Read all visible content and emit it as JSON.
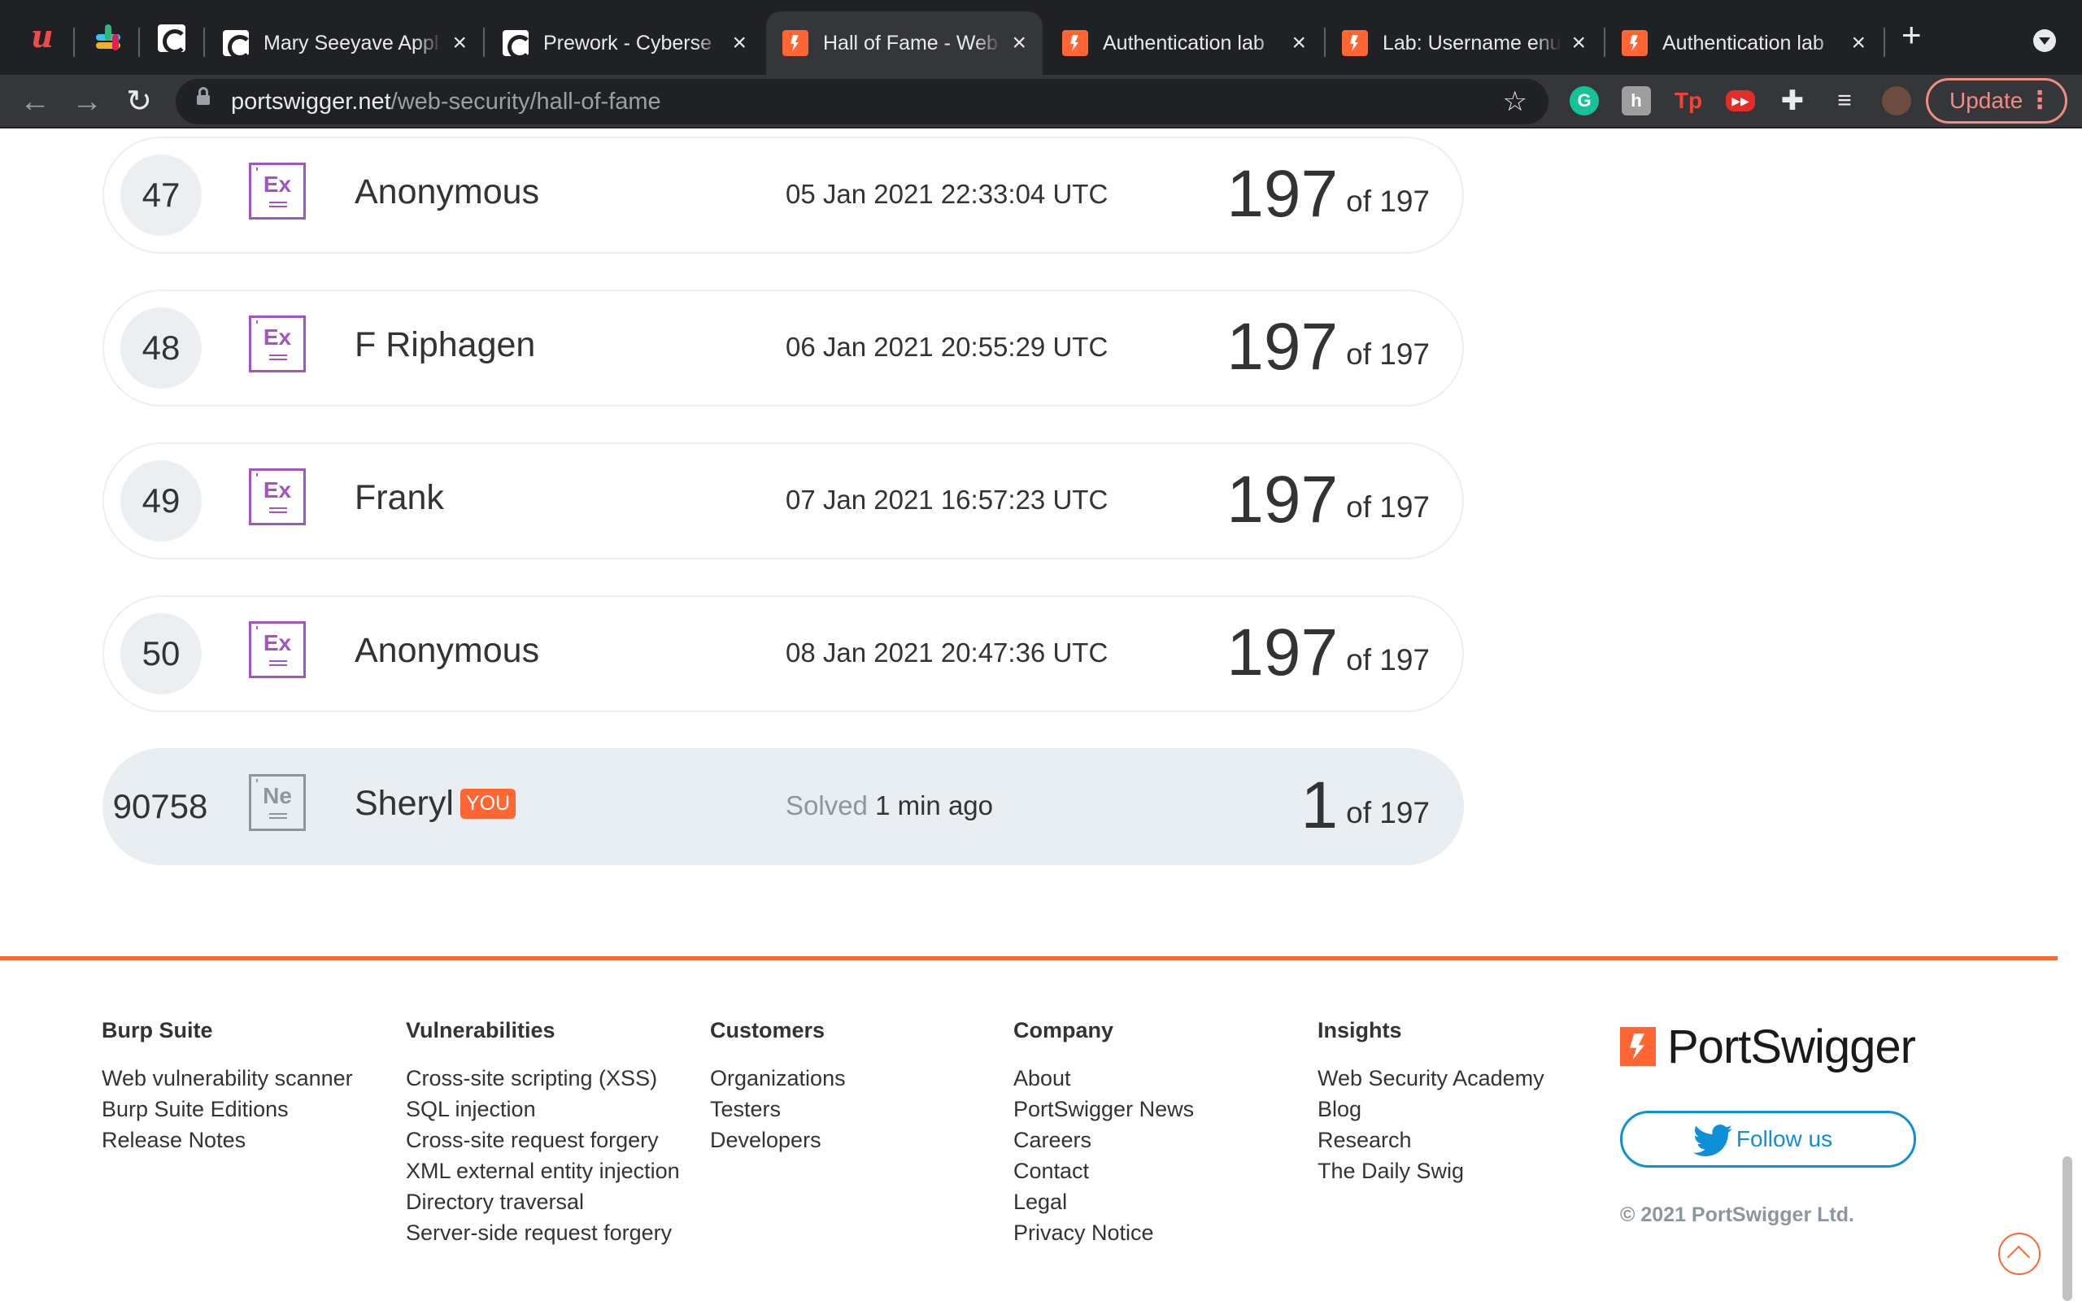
{
  "browser": {
    "tabs": [
      {
        "title": "Mary Seeyave Appl",
        "favicon": "codepath-icon"
      },
      {
        "title": "Prework - Cyberse",
        "favicon": "codepath-icon"
      },
      {
        "title": "Hall of Fame - Web",
        "favicon": "portswigger-icon",
        "active": true
      },
      {
        "title": "Authentication lab",
        "favicon": "portswigger-icon"
      },
      {
        "title": "Lab: Username enu",
        "favicon": "portswigger-icon"
      },
      {
        "title": "Authentication lab",
        "favicon": "portswigger-icon"
      }
    ],
    "close_glyph": "×",
    "new_tab_glyph": "+",
    "url_host": "portswigger.net",
    "url_path": "/web-security/hall-of-fame",
    "update_label": "Update",
    "extensions": [
      "grammarly-icon",
      "notion-icon",
      "tp-icon",
      "youtube-icon",
      "puzzle-icon",
      "playlist-icon"
    ]
  },
  "hall_of_fame": {
    "rows": [
      {
        "rank": "47",
        "badge": "Ex",
        "name": "Anonymous",
        "date": "05 Jan 2021 22:33:04 UTC",
        "score": "197",
        "of": "of 197"
      },
      {
        "rank": "48",
        "badge": "Ex",
        "name": "F Riphagen",
        "date": "06 Jan 2021 20:55:29 UTC",
        "score": "197",
        "of": "of 197"
      },
      {
        "rank": "49",
        "badge": "Ex",
        "name": "Frank",
        "date": "07 Jan 2021 16:57:23 UTC",
        "score": "197",
        "of": "of 197"
      },
      {
        "rank": "50",
        "badge": "Ex",
        "name": "Anonymous",
        "date": "08 Jan 2021 20:47:36 UTC",
        "score": "197",
        "of": "of 197"
      }
    ],
    "me": {
      "rank": "90758",
      "badge": "Ne",
      "name": "Sheryl",
      "you_tag": "YOU",
      "solved_label": "Solved",
      "solved_time": "1 min ago",
      "score": "1",
      "of": "of 197"
    }
  },
  "footer": {
    "columns": [
      {
        "heading": "Burp Suite",
        "links": [
          "Web vulnerability scanner",
          "Burp Suite Editions",
          "Release Notes"
        ]
      },
      {
        "heading": "Vulnerabilities",
        "links": [
          "Cross-site scripting (XSS)",
          "SQL injection",
          "Cross-site request forgery",
          "XML external entity injection",
          "Directory traversal",
          "Server-side request forgery"
        ]
      },
      {
        "heading": "Customers",
        "links": [
          "Organizations",
          "Testers",
          "Developers"
        ]
      },
      {
        "heading": "Company",
        "links": [
          "About",
          "PortSwigger News",
          "Careers",
          "Contact",
          "Legal",
          "Privacy Notice"
        ]
      },
      {
        "heading": "Insights",
        "links": [
          "Web Security Academy",
          "Blog",
          "Research",
          "The Daily Swig"
        ]
      }
    ],
    "logo_text": "PortSwigger",
    "follow_label": "Follow us",
    "copyright": "© 2021 PortSwigger Ltd."
  },
  "colors": {
    "brand": "#ff6633",
    "badge_expert": "#a154c2",
    "twitter": "#0e8fd9"
  }
}
